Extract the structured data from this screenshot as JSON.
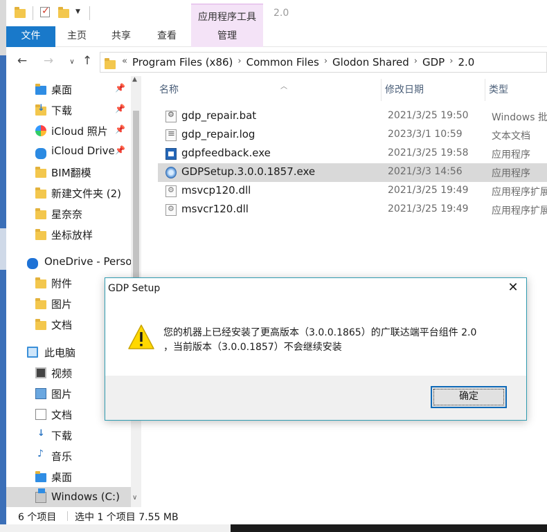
{
  "window": {
    "title": "2.0",
    "context_group": "应用程序工具"
  },
  "ribbon": {
    "tabs": [
      "文件",
      "主页",
      "共享",
      "查看",
      "管理"
    ]
  },
  "address": {
    "crumbs": [
      "Program Files (x86)",
      "Common Files",
      "Glodon Shared",
      "GDP",
      "2.0"
    ],
    "overflow": "«"
  },
  "sidebar": {
    "items": [
      {
        "label": "桌面",
        "pinned": true,
        "icon": "folder-icon"
      },
      {
        "label": "下载",
        "pinned": true,
        "icon": "download-folder-icon"
      },
      {
        "label": "iCloud 照片",
        "pinned": true,
        "icon": "icloud-photos-icon"
      },
      {
        "label": "iCloud Drive",
        "pinned": true,
        "icon": "icloud-drive-icon"
      },
      {
        "label": "BIM翻模",
        "pinned": false,
        "icon": "folder-icon"
      },
      {
        "label": "新建文件夹 (2)",
        "pinned": false,
        "icon": "folder-icon"
      },
      {
        "label": "星奈奈",
        "pinned": false,
        "icon": "folder-icon"
      },
      {
        "label": "坐标放样",
        "pinned": false,
        "icon": "folder-icon"
      },
      {
        "label": "OneDrive - Perso",
        "pinned": false,
        "icon": "onedrive-icon"
      },
      {
        "label": "附件",
        "pinned": false,
        "icon": "folder-icon"
      },
      {
        "label": "图片",
        "pinned": false,
        "icon": "folder-icon"
      },
      {
        "label": "文档",
        "pinned": false,
        "icon": "folder-icon"
      },
      {
        "label": "此电脑",
        "pinned": false,
        "icon": "pc-icon"
      },
      {
        "label": "视频",
        "pinned": false,
        "icon": "video-icon"
      },
      {
        "label": "图片",
        "pinned": false,
        "icon": "picture-icon"
      },
      {
        "label": "文档",
        "pinned": false,
        "icon": "document-icon"
      },
      {
        "label": "下载",
        "pinned": false,
        "icon": "download-icon"
      },
      {
        "label": "音乐",
        "pinned": false,
        "icon": "music-icon"
      },
      {
        "label": "桌面",
        "pinned": false,
        "icon": "desktop-icon"
      },
      {
        "label": "Windows (C:)",
        "pinned": false,
        "icon": "drive-icon"
      }
    ]
  },
  "columns": {
    "name": "名称",
    "date": "修改日期",
    "type": "类型"
  },
  "files": [
    {
      "name": "gdp_repair.bat",
      "date": "2021/3/25 19:50",
      "type": "Windows 批",
      "icon": "bat-file-icon"
    },
    {
      "name": "gdp_repair.log",
      "date": "2023/3/1 10:59",
      "type": "文本文档",
      "icon": "log-file-icon"
    },
    {
      "name": "gdpfeedback.exe",
      "date": "2021/3/25 19:58",
      "type": "应用程序",
      "icon": "exe-file-icon"
    },
    {
      "name": "GDPSetup.3.0.0.1857.exe",
      "date": "2021/3/3 14:56",
      "type": "应用程序",
      "icon": "setup-file-icon"
    },
    {
      "name": "msvcp120.dll",
      "date": "2021/3/25 19:49",
      "type": "应用程序扩展",
      "icon": "dll-file-icon"
    },
    {
      "name": "msvcr120.dll",
      "date": "2021/3/25 19:49",
      "type": "应用程序扩展",
      "icon": "dll-file-icon"
    }
  ],
  "status": {
    "count": "6 个项目",
    "selection": "选中 1 个项目  7.55 MB"
  },
  "dialog": {
    "title": "GDP Setup",
    "close": "✕",
    "message_line1": "您的机器上已经安装了更高版本（3.0.0.1865）的广联达端平台组件 2.0",
    "message_line2": "，当前版本（3.0.0.1857）不会继续安装",
    "ok_label": "确定"
  },
  "colors": {
    "accent": "#1979ca",
    "context": "#f4e3f7",
    "selection": "#d9d9d9",
    "dialog_border": "#2f9bb0"
  }
}
